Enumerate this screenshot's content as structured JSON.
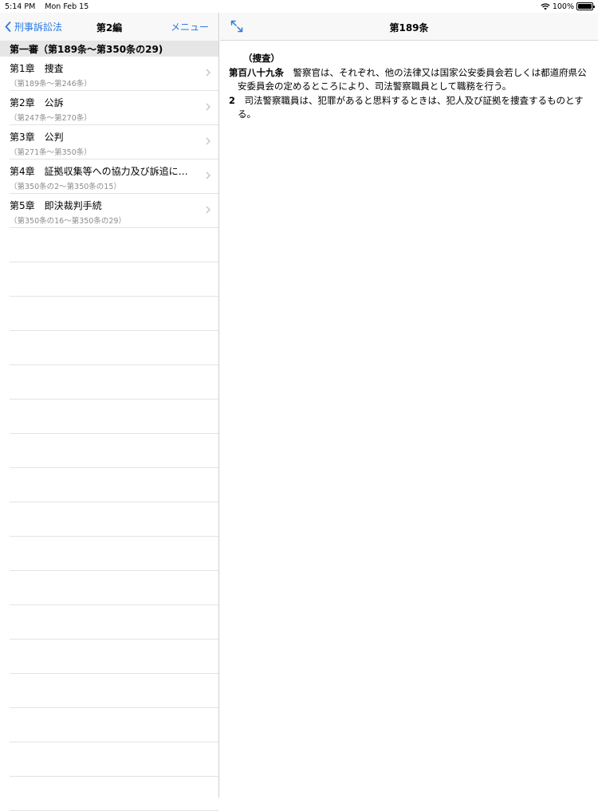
{
  "status": {
    "time": "5:14 PM",
    "date": "Mon Feb 15",
    "battery": "100%",
    "battery_level": 1.0
  },
  "left_nav": {
    "back_label": "刑事訴訟法",
    "title": "第2編",
    "menu_label": "メニュー"
  },
  "section": {
    "title": "第一審（第189条〜第350条の29)"
  },
  "chapters": [
    {
      "title": "第1章　捜査",
      "range": "（第189条〜第246条）"
    },
    {
      "title": "第2章　公訴",
      "range": "（第247条〜第270条）"
    },
    {
      "title": "第3章　公判",
      "range": "（第271条〜第350条）"
    },
    {
      "title": "第4章　証拠収集等への協力及び訴追に関…",
      "range": "（第350条の2〜第350条の15）"
    },
    {
      "title": "第5章　即決裁判手続",
      "range": "（第350条の16〜第350条の29）"
    }
  ],
  "right_nav": {
    "title": "第189条"
  },
  "article": {
    "caption": "（捜査）",
    "number": "第百八十九条",
    "para1": "警察官は、それぞれ、他の法律又は国家公安委員会若しくは都道府県公安委員会の定めるところにより、司法警察職員として職務を行う。",
    "para2_num": "2",
    "para2": "司法警察職員は、犯罪があると思料するときは、犯人及び証拠を捜査するものとする。"
  }
}
